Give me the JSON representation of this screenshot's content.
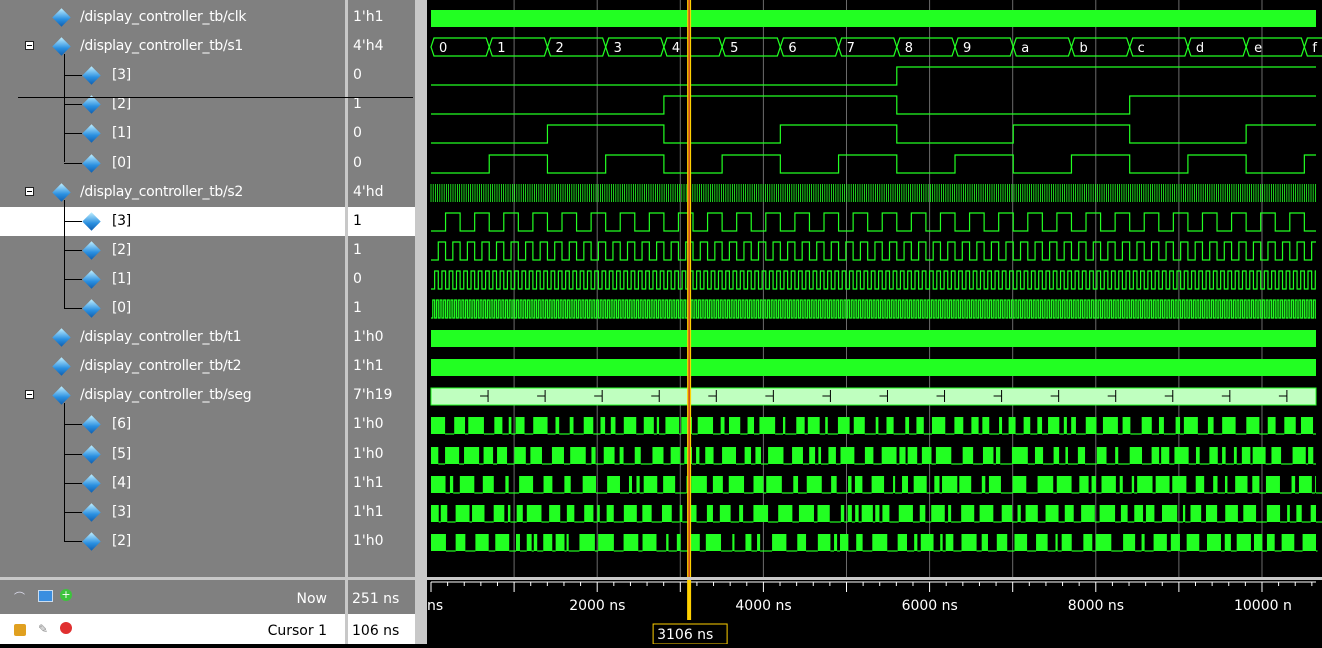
{
  "signals": [
    {
      "name": "/display_controller_tb/clk",
      "value": "1'h1",
      "level": 0,
      "expand": false
    },
    {
      "name": "/display_controller_tb/s1",
      "value": "4'h4",
      "level": 0,
      "expand": true
    },
    {
      "name": "[3]",
      "value": "0",
      "level": 1,
      "expand": false
    },
    {
      "name": "[2]",
      "value": "1",
      "level": 1,
      "expand": false
    },
    {
      "name": "[1]",
      "value": "0",
      "level": 1,
      "expand": false
    },
    {
      "name": "[0]",
      "value": "0",
      "level": 1,
      "expand": false
    },
    {
      "name": "/display_controller_tb/s2",
      "value": "4'hd",
      "level": 0,
      "expand": true
    },
    {
      "name": "[3]",
      "value": "1",
      "level": 1,
      "expand": false,
      "selected": true
    },
    {
      "name": "[2]",
      "value": "1",
      "level": 1,
      "expand": false
    },
    {
      "name": "[1]",
      "value": "0",
      "level": 1,
      "expand": false
    },
    {
      "name": "[0]",
      "value": "1",
      "level": 1,
      "expand": false
    },
    {
      "name": "/display_controller_tb/t1",
      "value": "1'h0",
      "level": 0,
      "expand": false
    },
    {
      "name": "/display_controller_tb/t2",
      "value": "1'h1",
      "level": 0,
      "expand": false
    },
    {
      "name": "/display_controller_tb/seg",
      "value": "7'h19",
      "level": 0,
      "expand": true
    },
    {
      "name": "[6]",
      "value": "1'h0",
      "level": 1,
      "expand": false
    },
    {
      "name": "[5]",
      "value": "1'h0",
      "level": 1,
      "expand": false
    },
    {
      "name": "[4]",
      "value": "1'h1",
      "level": 1,
      "expand": false
    },
    {
      "name": "[3]",
      "value": "1'h1",
      "level": 1,
      "expand": false
    },
    {
      "name": "[2]",
      "value": "1'h0",
      "level": 1,
      "expand": false
    }
  ],
  "bus_labels": {
    "s1": [
      "0",
      "1",
      "2",
      "3",
      "4",
      "5",
      "6",
      "7",
      "8",
      "9",
      "a",
      "b",
      "c",
      "d",
      "e",
      "f"
    ]
  },
  "now_label": "Now",
  "now_value": "251 ns",
  "cursor_label": "Cursor 1",
  "cursor_value": "106 ns",
  "cursor_time": "3106 ns",
  "timeline_labels": [
    "ns",
    "2000 ns",
    "4000 ns",
    "6000 ns",
    "8000 ns",
    "10000 n"
  ],
  "colors": {
    "wave": "#22ff22",
    "bus_light": "#bfffbf",
    "cursor": "#ffd000",
    "grid": "#6b6b6b"
  }
}
